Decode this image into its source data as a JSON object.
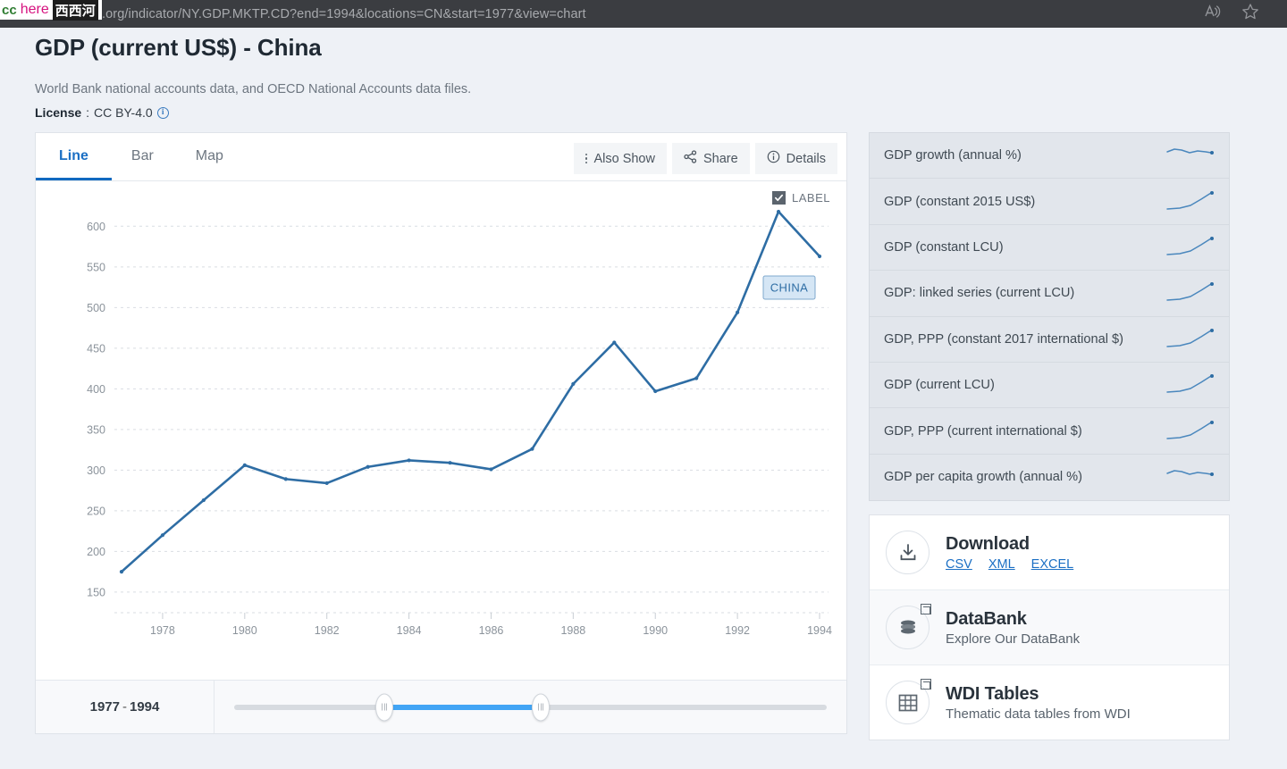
{
  "browser": {
    "url": "//data.worldbank.org/indicator/NY.GDP.MKTP.CD?end=1994&locations=CN&start=1977&view=chart",
    "read_aloud_icon": "read-aloud-icon",
    "favorite_icon": "star-icon"
  },
  "watermark": {
    "cc": "cc",
    "here": "here",
    "cn": "西西河"
  },
  "header": {
    "title": "GDP (current US$) - China",
    "source": "World Bank national accounts data, and OECD National Accounts data files.",
    "license_label": "License",
    "license_sep": ":",
    "license_value": "CC BY-4.0",
    "license_info_icon": "info-icon"
  },
  "chart_card": {
    "tabs": [
      {
        "label": "Line",
        "active": true
      },
      {
        "label": "Bar",
        "active": false
      },
      {
        "label": "Map",
        "active": false
      }
    ],
    "buttons": [
      {
        "label": "Also Show",
        "icon": "vertical-dots-icon"
      },
      {
        "label": "Share",
        "icon": "share-icon"
      },
      {
        "label": "Details",
        "icon": "info-icon"
      }
    ],
    "label_toggle": {
      "text": "LABEL",
      "checked": true
    },
    "slider": {
      "start_year": "1977",
      "separator": "-",
      "end_year": "1994"
    }
  },
  "chart_data": {
    "type": "line",
    "title": "GDP (current US$) - China",
    "xlabel": "",
    "ylabel": "",
    "series_name": "CHINA",
    "series_label": "CHINA",
    "line_color": "#2e6da4",
    "x": [
      1977,
      1978,
      1979,
      1980,
      1981,
      1982,
      1983,
      1984,
      1985,
      1986,
      1987,
      1988,
      1989,
      1990,
      1991,
      1992,
      1993,
      1994
    ],
    "values": [
      175,
      220,
      263,
      306,
      289,
      284,
      304,
      312,
      309,
      301,
      326,
      406,
      457,
      397,
      413,
      494,
      618,
      563
    ],
    "xticks": [
      1978,
      1980,
      1982,
      1984,
      1986,
      1988,
      1990,
      1992,
      1994
    ],
    "yticks": [
      150,
      200,
      250,
      300,
      350,
      400,
      450,
      500,
      550,
      600
    ],
    "ylim": [
      140,
      630
    ],
    "xlim": [
      1977,
      1994
    ],
    "grid": true,
    "legend": "inline-endpoint-label"
  },
  "indicators": [
    {
      "label": "GDP growth (annual %)",
      "spark": "flat"
    },
    {
      "label": "GDP (constant 2015 US$)",
      "spark": "rise"
    },
    {
      "label": "GDP (constant LCU)",
      "spark": "rise"
    },
    {
      "label": "GDP: linked series (current LCU)",
      "spark": "rise"
    },
    {
      "label": "GDP, PPP (constant 2017 international $)",
      "spark": "rise"
    },
    {
      "label": "GDP (current LCU)",
      "spark": "rise"
    },
    {
      "label": "GDP, PPP (current international $)",
      "spark": "rise"
    },
    {
      "label": "GDP per capita growth (annual %)",
      "spark": "flat"
    }
  ],
  "links": {
    "download": {
      "title": "Download",
      "icon": "download-icon",
      "formats": [
        "CSV",
        "XML",
        "EXCEL"
      ]
    },
    "databank": {
      "title": "DataBank",
      "subtitle": "Explore Our DataBank",
      "icon": "database-icon",
      "external": true
    },
    "wdi": {
      "title": "WDI Tables",
      "subtitle": "Thematic data tables from WDI",
      "icon": "table-grid-icon",
      "external": true
    }
  }
}
